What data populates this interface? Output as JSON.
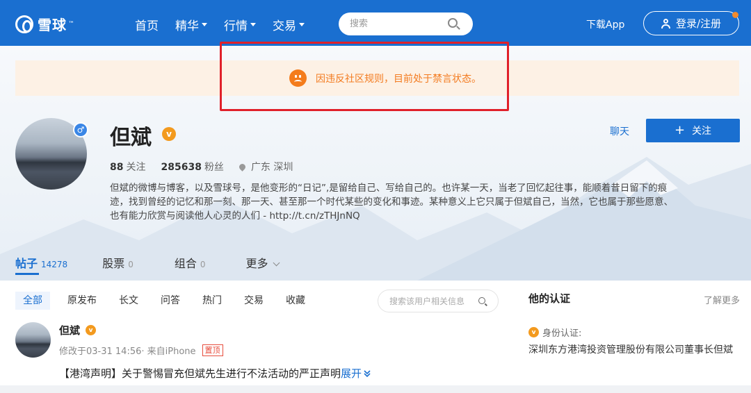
{
  "colors": {
    "brand": "#1a6fd0",
    "notice_bg": "#fdf1e5",
    "notice_text": "#f37b20",
    "verified": "#f39a1e",
    "highlight_frame": "#e0202a"
  },
  "header": {
    "logo_text": "雪球",
    "logo_tm": "™",
    "nav": [
      {
        "label": "首页",
        "has_caret": false
      },
      {
        "label": "精华",
        "has_caret": true
      },
      {
        "label": "行情",
        "has_caret": true
      },
      {
        "label": "交易",
        "has_caret": true
      }
    ],
    "search_placeholder": "搜索",
    "download_label": "下载App",
    "login_label": "登录/注册",
    "icons": {
      "search": "search-icon",
      "user": "user-icon"
    }
  },
  "notice": {
    "icon": "sad-face-icon",
    "text": "因违反社区规则，目前处于禁言状态。"
  },
  "profile": {
    "name": "但斌",
    "gender_symbol": "♂",
    "verified_mark": "v",
    "following_count": "88",
    "following_label": "关注",
    "followers_count": "285638",
    "followers_label": "粉丝",
    "location": "广东 深圳",
    "bio": "但斌的微博与博客，以及雪球号，是他变形的“日记”,是留给自己、写给自己的。也许某一天，当老了回忆起往事，能顺着昔日留下的痕迹，找到曾经的记忆和那一刻、那一天、甚至那一个时代某些的变化和事迹。某种意义上它只属于但斌自己，当然，它也属于那些愿意、也有能力欣赏与阅读他人心灵的人们 - http://t.cn/zTHJnNQ",
    "chat_label": "聊天",
    "follow_label": "关注",
    "follow_plus": "+"
  },
  "tabs": [
    {
      "label": "帖子",
      "count": "14278",
      "active": true
    },
    {
      "label": "股票",
      "count": "0",
      "active": false
    },
    {
      "label": "组合",
      "count": "0",
      "active": false
    },
    {
      "label": "更多",
      "count": "",
      "active": false
    }
  ],
  "filters": [
    {
      "label": "全部",
      "active": true
    },
    {
      "label": "原发布",
      "active": false
    },
    {
      "label": "长文",
      "active": false
    },
    {
      "label": "问答",
      "active": false
    },
    {
      "label": "热门",
      "active": false
    },
    {
      "label": "交易",
      "active": false
    },
    {
      "label": "收藏",
      "active": false
    }
  ],
  "user_search_placeholder": "搜索该用户相关信息",
  "post": {
    "author": "但斌",
    "verified_mark": "v",
    "meta": "修改于03-31 14:56· 来自iPhone",
    "pin_tag": "置顶",
    "title": "【港湾声明】关于警惕冒充但斌先生进行不法活动的严正声明",
    "expand_label": "展开"
  },
  "sidebar": {
    "title": "他的认证",
    "more_label": "了解更多",
    "cert_label": "身份认证:",
    "cert_mark": "v",
    "cert_desc": "深圳东方港湾投资管理股份有限公司董事长但斌"
  }
}
